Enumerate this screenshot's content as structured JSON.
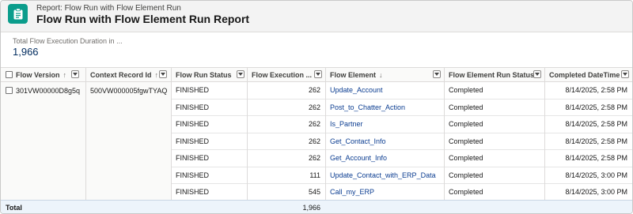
{
  "header": {
    "eyebrow": "Report: Flow Run with Flow Element Run",
    "title": "Flow Run with Flow Element Run Report",
    "icon": "report-icon",
    "icon_color": "#0b9d8c"
  },
  "summary": {
    "label": "Total Flow Execution Duration in ...",
    "value": "1,966"
  },
  "columns": [
    {
      "label": "Flow Version",
      "sort": "↑"
    },
    {
      "label": "Context Record Id",
      "sort": "↑"
    },
    {
      "label": "Flow Run Status",
      "sort": ""
    },
    {
      "label": "Flow Execution ...",
      "sort": ""
    },
    {
      "label": "Flow Element",
      "sort": "↓"
    },
    {
      "label": "Flow Element Run Status",
      "sort": ""
    },
    {
      "label": "Completed DateTime",
      "sort": ""
    }
  ],
  "group": {
    "flow_version": "301VW00000D8g5q",
    "context_record_id": "500VW000005fgwTYAQ"
  },
  "rows": [
    {
      "status": "FINISHED",
      "duration": "262",
      "element": "Update_Account",
      "element_status": "Completed",
      "completed": "8/14/2025, 2:58 PM"
    },
    {
      "status": "FINISHED",
      "duration": "262",
      "element": "Post_to_Chatter_Action",
      "element_status": "Completed",
      "completed": "8/14/2025, 2:58 PM"
    },
    {
      "status": "FINISHED",
      "duration": "262",
      "element": "Is_Partner",
      "element_status": "Completed",
      "completed": "8/14/2025, 2:58 PM"
    },
    {
      "status": "FINISHED",
      "duration": "262",
      "element": "Get_Contact_Info",
      "element_status": "Completed",
      "completed": "8/14/2025, 2:58 PM"
    },
    {
      "status": "FINISHED",
      "duration": "262",
      "element": "Get_Account_Info",
      "element_status": "Completed",
      "completed": "8/14/2025, 2:58 PM"
    },
    {
      "status": "FINISHED",
      "duration": "111",
      "element": "Update_Contact_with_ERP_Data",
      "element_status": "Completed",
      "completed": "8/14/2025, 3:00 PM"
    },
    {
      "status": "FINISHED",
      "duration": "545",
      "element": "Call_my_ERP",
      "element_status": "Completed",
      "completed": "8/14/2025, 3:00 PM"
    }
  ],
  "total": {
    "label": "Total",
    "duration": "1,966"
  }
}
